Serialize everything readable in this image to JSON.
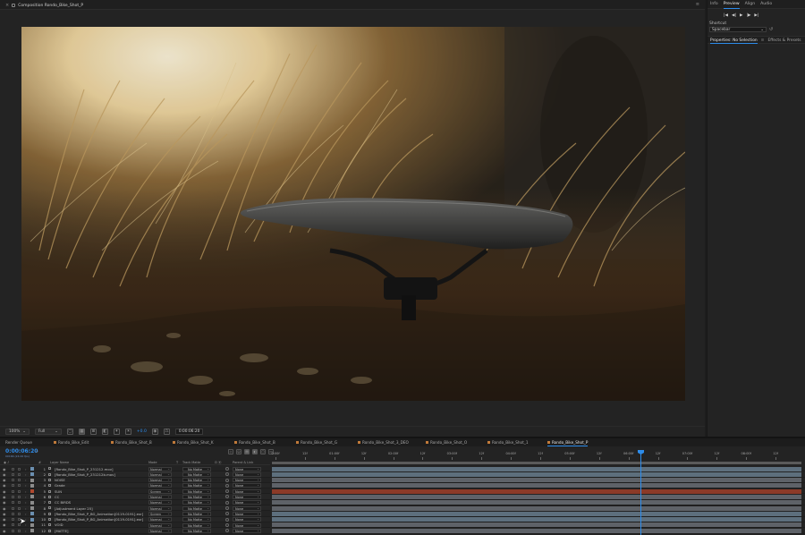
{
  "composition": {
    "tab_label": "Composition Rondo_Bike_Shot_P",
    "menu_icon": "hamburger-menu-icon",
    "image_description_icon": "composition-viewer"
  },
  "viewer_toolbar": {
    "magnification": "100%",
    "resolution": "Full",
    "exposure_value": "+0.0",
    "current_time": "0:00:06:20"
  },
  "right_panel": {
    "tabs": [
      "Info",
      "Preview",
      "Align",
      "Audio"
    ],
    "active_tab": "Preview",
    "preview_buttons": [
      "|◀",
      "◀|",
      "▶",
      "|▶",
      "▶|"
    ],
    "shortcut_label": "Shortcut",
    "shortcut_value": "Spacebar",
    "lower_tabs": [
      "Properties: No Selection",
      "Effects & Presets"
    ],
    "lower_active": "Properties: No Selection"
  },
  "timeline": {
    "tabs": [
      {
        "label": "Render Queue",
        "color": ""
      },
      {
        "label": "Rondo_Bike_Edit",
        "color": "#c07a3a"
      },
      {
        "label": "Rondo_Bike_Shot_B",
        "color": "#c07a3a"
      },
      {
        "label": "Rondo_Bike_Shot_K",
        "color": "#c07a3a"
      },
      {
        "label": "Rondo_Bike_Shot_B",
        "color": "#c07a3a"
      },
      {
        "label": "Rondo_Bike_Shot_G",
        "color": "#c07a3a"
      },
      {
        "label": "Rondo_Bike_Shot_3_DEO",
        "color": "#c07a3a"
      },
      {
        "label": "Rondo_Bike_Shot_O",
        "color": "#c07a3a"
      },
      {
        "label": "Rondo_Bike_Shot_1",
        "color": "#c07a3a"
      },
      {
        "label": "Rondo_Bike_Shot_P",
        "color": "#c07a3a"
      }
    ],
    "active_tab": "Rondo_Bike_Shot_P",
    "timecode": "0:00:06:20",
    "fps": "00166 (24.00 fps)",
    "columns": {
      "num": "#",
      "layer_name": "Layer Name",
      "mode": "Mode",
      "t": "T",
      "trkmat": "Track Matte",
      "parent": "Parent & Link"
    },
    "ruler_labels": [
      "0:00f",
      "12f",
      "01:00f",
      "12f",
      "02:00f",
      "12f",
      "03:00f",
      "12f",
      "04:00f",
      "12f",
      "05:00f",
      "12f",
      "06:00f",
      "12f",
      "07:00f",
      "12f",
      "08:00f",
      "12f"
    ],
    "layers": [
      {
        "num": "1",
        "name": "[Rondo_Bike_Shot_P_231212.mov]",
        "mode": "Normal",
        "trkmat": "No Matte",
        "parent": "None",
        "label_color": "#6b8fb0",
        "bar_color": "#5d6f7d"
      },
      {
        "num": "2",
        "name": "[Rondo_Bike_Shot_P_231212b.mov]",
        "mode": "Normal",
        "trkmat": "No Matte",
        "parent": "None",
        "label_color": "#6b8fb0",
        "bar_color": "#5d6f7d"
      },
      {
        "num": "3",
        "name": "NOISE",
        "mode": "Normal",
        "trkmat": "No Matte",
        "parent": "None",
        "label_color": "#8c8c8c",
        "bar_color": "#5e6268"
      },
      {
        "num": "4",
        "name": "Grade",
        "mode": "Normal",
        "trkmat": "No Matte",
        "parent": "None",
        "label_color": "#8c8c8c",
        "bar_color": "#5e6268"
      },
      {
        "num": "5",
        "name": "SUN",
        "mode": "Screen",
        "trkmat": "No Matte",
        "parent": "None",
        "label_color": "#b0492f",
        "bar_color": "#8b3a27"
      },
      {
        "num": "6",
        "name": "CC",
        "mode": "Normal",
        "trkmat": "No Matte",
        "parent": "None",
        "label_color": "#8c8c8c",
        "bar_color": "#5e6268"
      },
      {
        "num": "7",
        "name": "CC BIRDS",
        "mode": "Normal",
        "trkmat": "No Matte",
        "parent": "None",
        "label_color": "#8c8c8c",
        "bar_color": "#5e6268"
      },
      {
        "num": "8",
        "name": "[Adjustment Layer 25]",
        "mode": "Normal",
        "trkmat": "No Matte",
        "parent": "None",
        "label_color": "#8c8c8c",
        "bar_color": "#5e6268"
      },
      {
        "num": "9",
        "name": "[Rondo_Bike_Shot_P_BG_Animation[0119-0191].exr]",
        "mode": "Screen",
        "trkmat": "No Matte",
        "parent": "None",
        "label_color": "#6b8fb0",
        "bar_color": "#5d6f7d"
      },
      {
        "num": "10",
        "name": "[Rondo_Bike_Shot_P_BG_Animation[0119-0191].exr]",
        "mode": "Normal",
        "trkmat": "No Matte",
        "parent": "None",
        "label_color": "#6b8fb0",
        "bar_color": "#5d6f7d"
      },
      {
        "num": "11",
        "name": "VOID",
        "mode": "Normal",
        "trkmat": "No Matte",
        "parent": "None",
        "label_color": "#8c8c8c",
        "bar_color": "#5e6268"
      },
      {
        "num": "12",
        "name": "[MATTE]",
        "mode": "Normal",
        "trkmat": "No Matte",
        "parent": "None",
        "label_color": "#8c8c8c",
        "bar_color": "#5e6268"
      }
    ],
    "playhead_time": "0:00:06:20"
  },
  "colors": {
    "accent": "#2d8ceb",
    "panel_bg": "#232323",
    "sun_layer": "#8b3a27"
  }
}
